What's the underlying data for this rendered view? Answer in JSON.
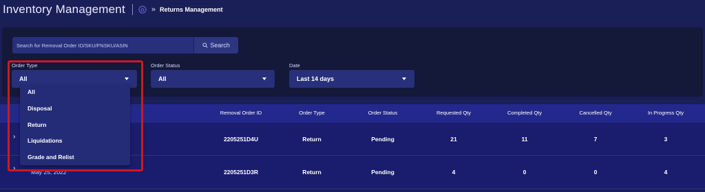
{
  "header": {
    "app_title": "Inventory Management",
    "breadcrumb_sep": "»",
    "breadcrumb_current": "Returns Management"
  },
  "search": {
    "placeholder": "Search for Removal Order ID/SKU/FNSKU/ASIN",
    "button_label": "Search"
  },
  "filters": {
    "order_type": {
      "label": "Order Type",
      "value": "All"
    },
    "order_status": {
      "label": "Order Status",
      "value": "All"
    },
    "date": {
      "label": "Date",
      "value": "Last 14 days"
    }
  },
  "order_type_menu": {
    "options": [
      "All",
      "Disposal",
      "Return",
      "Liquidations",
      "Grade and Relist"
    ]
  },
  "table": {
    "columns": [
      "Removal Order ID",
      "Order Type",
      "Order Status",
      "Requested Qty",
      "Completed Qty",
      "Cancelled Qty",
      "In Progress Qty"
    ],
    "rows": [
      {
        "expander": "›",
        "date": "",
        "removal_order_id": "2205251D4U",
        "order_type": "Return",
        "order_status": "Pending",
        "requested_qty": "21",
        "completed_qty": "11",
        "cancelled_qty": "7",
        "in_progress_qty": "3"
      },
      {
        "expander": "›",
        "date": "May 25, 2022",
        "removal_order_id": "2205251D3R",
        "order_type": "Return",
        "order_status": "Pending",
        "requested_qty": "4",
        "completed_qty": "0",
        "cancelled_qty": "0",
        "in_progress_qty": "4"
      }
    ]
  },
  "colors": {
    "page_bg": "#1b1f57",
    "panel_bg": "#141839",
    "control_bg": "#28307c",
    "table_header_bg": "#23298c",
    "row_bg": "#1a1c6e",
    "highlight": "#d01820"
  }
}
